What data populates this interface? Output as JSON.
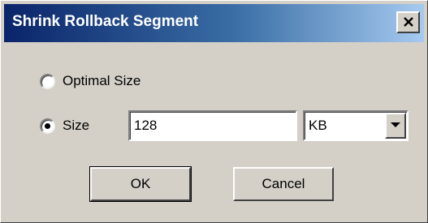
{
  "window": {
    "title": "Shrink Rollback Segment",
    "close_icon": "close-icon"
  },
  "options": {
    "optimal_label": "Optimal Size",
    "size_label": "Size",
    "selected": "size"
  },
  "size": {
    "value": "128",
    "unit": "KB"
  },
  "buttons": {
    "ok": "OK",
    "cancel": "Cancel"
  },
  "colors": {
    "title_start": "#0a246a",
    "title_end": "#a6caf0",
    "face": "#d4d0c8"
  }
}
